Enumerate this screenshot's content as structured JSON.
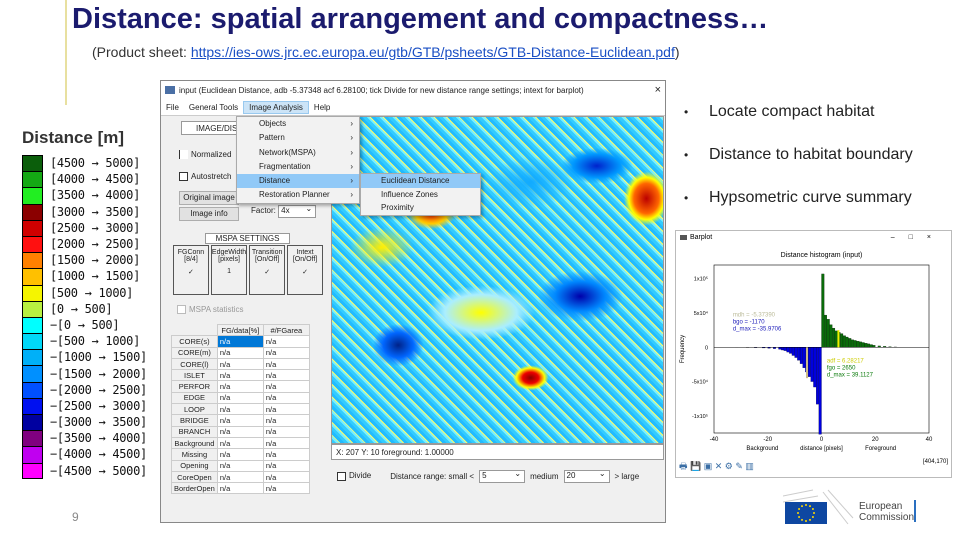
{
  "slide": {
    "title": "Distance: spatial arrangement and compactness…",
    "subtitle_prefix": "(Product sheet: ",
    "subtitle_link": "https://ies-ows.jrc.ec.europa.eu/gtb/GTB/psheets/GTB-Distance-Euclidean.pdf",
    "subtitle_suffix": ")",
    "page_number": "9"
  },
  "legend": {
    "title": "Distance [m]",
    "items": [
      {
        "label": "[4500 → 5000]",
        "color": "#0b5e0b"
      },
      {
        "label": "[4000 → 4500]",
        "color": "#14a814"
      },
      {
        "label": "[3500 → 4000]",
        "color": "#22ee22"
      },
      {
        "label": "[3000 → 3500]",
        "color": "#8b0000"
      },
      {
        "label": "[2500 → 3000]",
        "color": "#d00000"
      },
      {
        "label": "[2000 → 2500]",
        "color": "#ff1010"
      },
      {
        "label": "[1500 → 2000]",
        "color": "#ff8000"
      },
      {
        "label": "[1000 → 1500]",
        "color": "#ffc000"
      },
      {
        "label": "[500 → 1000]",
        "color": "#f5f500"
      },
      {
        "label": "[0 → 500]",
        "color": "#b8f040"
      },
      {
        "label": "−[0 → 500]",
        "color": "#00ffff"
      },
      {
        "label": "−[500 → 1000]",
        "color": "#00d8f8"
      },
      {
        "label": "−[1000 → 1500]",
        "color": "#00b0f8"
      },
      {
        "label": "−[1500 → 2000]",
        "color": "#0090ff"
      },
      {
        "label": "−[2000 → 2500]",
        "color": "#0050ff"
      },
      {
        "label": "−[2500 → 3000]",
        "color": "#0010f0"
      },
      {
        "label": "−[3000 → 3500]",
        "color": "#0000a0"
      },
      {
        "label": "−[3500 → 4000]",
        "color": "#800080"
      },
      {
        "label": "−[4000 → 4500]",
        "color": "#c000f0"
      },
      {
        "label": "−[4500 → 5000]",
        "color": "#ff00ff"
      }
    ]
  },
  "app": {
    "window_title": "input (Euclidean Distance, adb -5.37348 acf 6.28100; tick Divide for new distance range settings; intext for barplot)",
    "close": "×",
    "menu": [
      "File",
      "General Tools",
      "Image Analysis",
      "Help"
    ],
    "dropdown": [
      {
        "label": "Objects"
      },
      {
        "label": "Pattern"
      },
      {
        "label": "Network(MSPA)"
      },
      {
        "label": "Fragmentation"
      },
      {
        "label": "Distance"
      },
      {
        "label": "Restoration Planner"
      }
    ],
    "submenu": [
      "Euclidean Distance",
      "Influence Zones",
      "Proximity"
    ],
    "left": {
      "image_display": "IMAGE/DISP",
      "normalized": "Normalized",
      "autostretch": "Autostretch",
      "original_image": "Original image",
      "image_info": "Image info",
      "factor_label": "Factor:",
      "factor_value": "4x",
      "mspa_settings": "MSPA SETTINGS",
      "mspa_cols": [
        {
          "h": "FGConn [8/4]",
          "v": "✓"
        },
        {
          "h": "EdgeWidth [pixels]",
          "v": "1"
        },
        {
          "h": "Transition [On/Off]",
          "v": "✓"
        },
        {
          "h": "Intext [On/Off]",
          "v": "✓"
        }
      ],
      "mspa_statistics": "MSPA statistics",
      "table_headers": [
        "FG/data[%]",
        "#/FGarea"
      ],
      "table_rows": [
        {
          "name": "CORE(s)",
          "a": "n/a",
          "b": "n/a"
        },
        {
          "name": "CORE(m)",
          "a": "n/a",
          "b": "n/a"
        },
        {
          "name": "CORE(l)",
          "a": "n/a",
          "b": "n/a"
        },
        {
          "name": "ISLET",
          "a": "n/a",
          "b": "n/a"
        },
        {
          "name": "PERFOR",
          "a": "n/a",
          "b": "n/a"
        },
        {
          "name": "EDGE",
          "a": "n/a",
          "b": "n/a"
        },
        {
          "name": "LOOP",
          "a": "n/a",
          "b": "n/a"
        },
        {
          "name": "BRIDGE",
          "a": "n/a",
          "b": "n/a"
        },
        {
          "name": "BRANCH",
          "a": "n/a",
          "b": "n/a"
        },
        {
          "name": "Background",
          "a": "n/a",
          "b": "n/a"
        },
        {
          "name": "Missing",
          "a": "n/a",
          "b": "n/a"
        },
        {
          "name": "Opening",
          "a": "n/a",
          "b": "n/a"
        },
        {
          "name": "CoreOpen",
          "a": "n/a",
          "b": "n/a"
        },
        {
          "name": "BorderOpen",
          "a": "n/a",
          "b": "n/a"
        }
      ]
    },
    "status": "X: 207  Y: 10   foreground: 1.00000",
    "divide": "Divide",
    "range_label": "Distance range:  small <",
    "small_value": "5",
    "medium": "medium",
    "medium_value": "20",
    "large": "> large"
  },
  "bullets": [
    "Locate compact habitat",
    "Distance to habitat boundary",
    "Hypsometric curve summary"
  ],
  "histogram": {
    "window_title": "Barplot",
    "chart_data": {
      "type": "bar",
      "title": "Distance histogram (input)",
      "xlabel": "distance [pixels]",
      "ylabel": "Frequency",
      "x_left_label": "Background",
      "x_right_label": "Foreground",
      "xlim": [
        -40,
        40
      ],
      "ylim": [
        -1.25,
        1.2
      ],
      "xticks": [
        "-40",
        "-20",
        "0",
        "20",
        "40"
      ],
      "yticks": [
        "1x10⁵",
        "5x10⁴",
        "0",
        "-5x10⁴",
        "-1x10⁵"
      ],
      "foreground": {
        "x": [
          1,
          2,
          3,
          4,
          5,
          6,
          7,
          8,
          9,
          10,
          11,
          12,
          13,
          14,
          15,
          16,
          17,
          18,
          19,
          20,
          22,
          24,
          26,
          28
        ],
        "values": [
          1.07,
          0.47,
          0.41,
          0.33,
          0.28,
          0.24,
          0.22,
          0.2,
          0.17,
          0.15,
          0.13,
          0.11,
          0.1,
          0.09,
          0.08,
          0.07,
          0.06,
          0.05,
          0.04,
          0.03,
          0.02,
          0.015,
          0.01,
          0.005
        ],
        "color": "#0a6b0a"
      },
      "background": {
        "x": [
          -1,
          -2,
          -3,
          -4,
          -5,
          -6,
          -7,
          -8,
          -9,
          -10,
          -11,
          -12,
          -13,
          -14,
          -15,
          -16,
          -18,
          -20,
          -22,
          -25,
          -28,
          -32
        ],
        "values": [
          -1.27,
          -0.83,
          -0.58,
          -0.5,
          -0.43,
          -0.36,
          -0.3,
          -0.24,
          -0.19,
          -0.15,
          -0.12,
          -0.09,
          -0.07,
          -0.05,
          -0.04,
          -0.03,
          -0.02,
          -0.015,
          -0.01,
          -0.006,
          -0.003,
          -0.001
        ],
        "color": "#0000dd"
      },
      "annot_bg": [
        "mdh = -5.37390",
        "bgo = -1170",
        "d_max = -35.9706"
      ],
      "annot_fg": [
        "adf = 6.28217",
        "fgo = 2650",
        "d_max = 39.1127"
      ],
      "status": "[404,170]"
    }
  },
  "logo": {
    "text1": "European",
    "text2": "Commission"
  }
}
